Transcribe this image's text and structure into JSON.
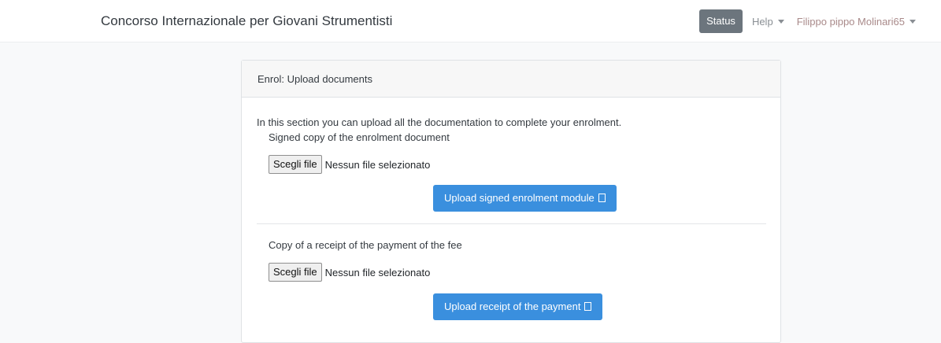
{
  "navbar": {
    "brand": "Concorso Internazionale per Giovani Strumentisti",
    "status_label": "Status",
    "help_label": "Help",
    "user_label": "Filippo pippo Molinari65"
  },
  "card": {
    "header": "Enrol: Upload documents",
    "intro": "In this section you can upload all the documentation to complete your enrolment.",
    "sections": [
      {
        "label": "Signed copy of the enrolment document",
        "file_button": "Scegli file",
        "file_status": "Nessun file selezionato",
        "upload_label": "Upload signed enrolment module"
      },
      {
        "label": "Copy of a receipt of the payment of the fee",
        "file_button": "Scegli file",
        "file_status": "Nessun file selezionato",
        "upload_label": "Upload receipt of the payment"
      }
    ]
  }
}
